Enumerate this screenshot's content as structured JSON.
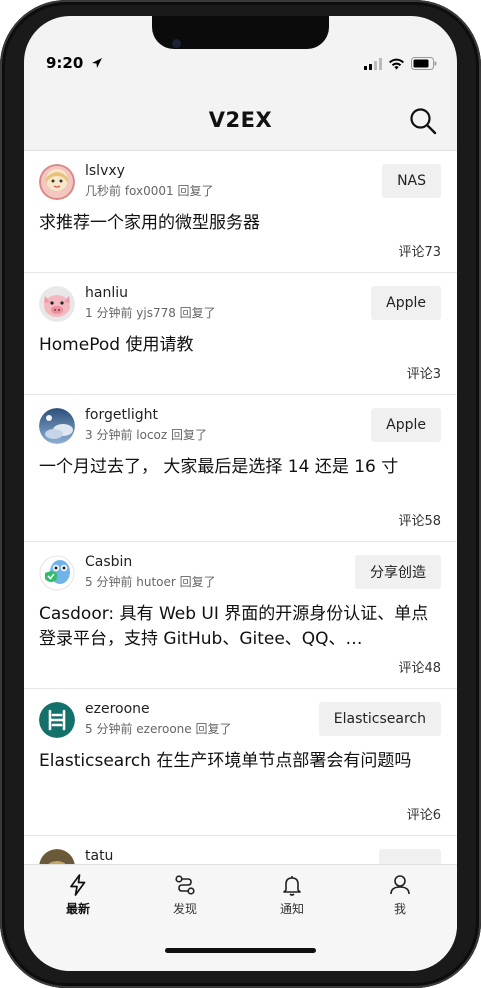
{
  "status_bar": {
    "time": "9:20"
  },
  "nav": {
    "title": "V2EX"
  },
  "feed": [
    {
      "user": "lslvxy",
      "meta": "几秒前 fox0001 回复了",
      "tag": "NAS",
      "title": "求推荐一个家用的微型服务器",
      "comments": "评论73"
    },
    {
      "user": "hanliu",
      "meta": "1 分钟前 yjs778 回复了",
      "tag": "Apple",
      "title": "HomePod 使用请教",
      "comments": "评论3"
    },
    {
      "user": "forgetlight",
      "meta": "3 分钟前 locoz 回复了",
      "tag": "Apple",
      "title": "一个月过去了， 大家最后是选择 14 还是 16 寸",
      "comments": "评论58"
    },
    {
      "user": "Casbin",
      "meta": "5 分钟前 hutoer 回复了",
      "tag": "分享创造",
      "title": "Casdoor: 具有 Web UI 界面的开源身份认证、单点登录平台，支持 GitHub、Gitee、QQ、…",
      "comments": "评论48"
    },
    {
      "user": "ezeroone",
      "meta": "5 分钟前 ezeroone 回复了",
      "tag": "Elasticsearch",
      "title": "Elasticsearch 在生产环境单节点部署会有问题吗",
      "comments": "评论6"
    },
    {
      "user": "tatu",
      "meta": "",
      "tag": "",
      "title": "",
      "comments": ""
    }
  ],
  "tabs": [
    {
      "label": "最新",
      "icon": "bolt-icon",
      "active": true
    },
    {
      "label": "发现",
      "icon": "route-icon",
      "active": false
    },
    {
      "label": "通知",
      "icon": "bell-icon",
      "active": false
    },
    {
      "label": "我",
      "icon": "person-icon",
      "active": false
    }
  ],
  "colors": {
    "tab_active": "#111111",
    "tag_bg": "#f0f0f0",
    "background": "#f3f3f3"
  }
}
